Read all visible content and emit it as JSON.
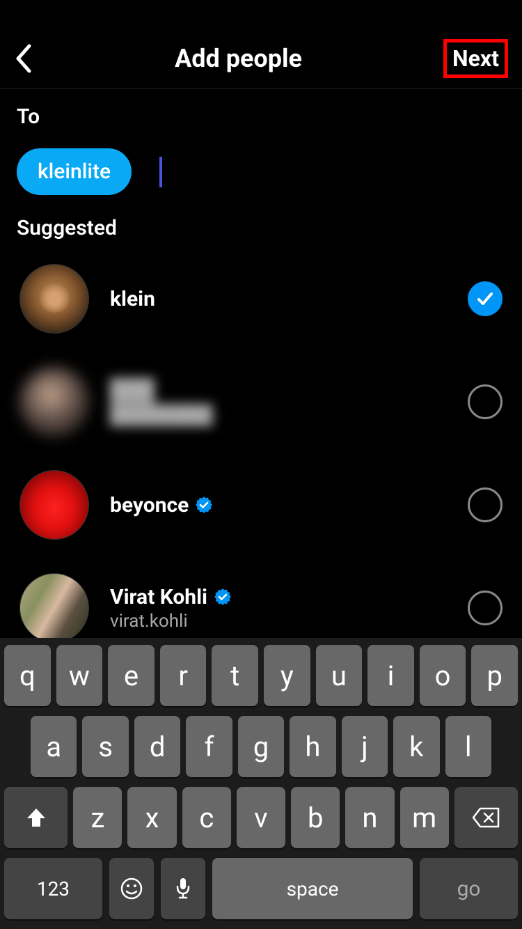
{
  "header": {
    "title": "Add people",
    "next_label": "Next"
  },
  "to": {
    "label": "To",
    "chips": [
      "kleinlite"
    ]
  },
  "suggested": {
    "label": "Suggested",
    "items": [
      {
        "name": "klein",
        "username": "",
        "verified": false,
        "selected": true,
        "avatar_style": "dog"
      },
      {
        "name": "",
        "username": "",
        "verified": false,
        "selected": false,
        "avatar_style": "blur",
        "blurred": true
      },
      {
        "name": "beyonce",
        "username": "",
        "verified": true,
        "selected": false,
        "avatar_style": "red"
      },
      {
        "name": "Virat Kohli",
        "username": "virat.kohli",
        "verified": true,
        "selected": false,
        "avatar_style": "couple"
      }
    ]
  },
  "keyboard": {
    "row1": [
      "q",
      "w",
      "e",
      "r",
      "t",
      "y",
      "u",
      "i",
      "o",
      "p"
    ],
    "row2": [
      "a",
      "s",
      "d",
      "f",
      "g",
      "h",
      "j",
      "k",
      "l"
    ],
    "row3": [
      "z",
      "x",
      "c",
      "v",
      "b",
      "n",
      "m"
    ],
    "num_label": "123",
    "space_label": "space",
    "go_label": "go"
  }
}
